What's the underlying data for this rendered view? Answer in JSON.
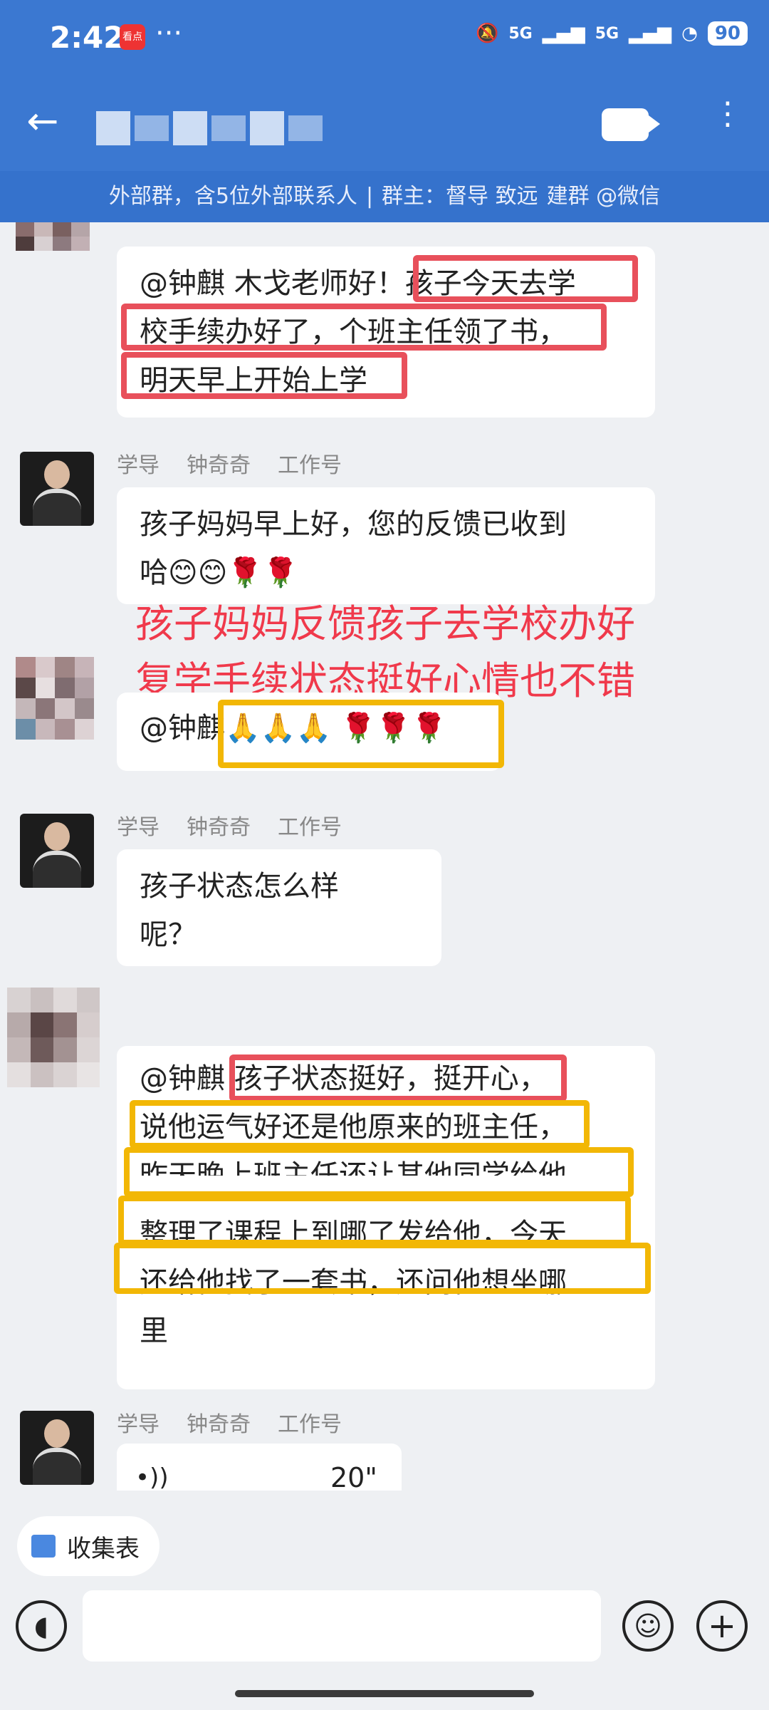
{
  "status_bar": {
    "time": "2:42",
    "app_badge": "看点",
    "dots": "···",
    "signal1": "5G",
    "signal2": "5G",
    "battery": "90"
  },
  "header": {
    "group_info": [
      "外部群，含5位外部联系人",
      "|",
      "群主：督导 致远",
      "建群 @微信"
    ]
  },
  "messages": [
    {
      "id": "m1",
      "lines": [
        "@钟麒 木戈老师好！孩子今天去学",
        "校手续办好了，个班主任领了书，",
        "明天早上开始上学"
      ]
    },
    {
      "id": "m2",
      "sender": [
        "学导",
        "钟奇奇",
        "工作号"
      ],
      "lines": [
        "孩子妈妈早上好，您的反馈已收到",
        "哈😊😊🌹🌹"
      ]
    },
    {
      "id": "m3",
      "lines": [
        "@钟麒🙏🙏🙏 🌹🌹🌹"
      ]
    },
    {
      "id": "m4",
      "sender": [
        "学导",
        "钟奇奇",
        "工作号"
      ],
      "lines": [
        "孩子状态怎么样",
        "呢？"
      ]
    },
    {
      "id": "m5",
      "lines": [
        "@钟麒 孩子状态挺好，挺开心，",
        "说他运气好还是他原来的班主任，",
        "昨天晚上班主任还让其他同学给他",
        "整理了课程上到哪了发给他，今天",
        "还给他找了一套书，还问他想坐哪",
        "里"
      ]
    },
    {
      "id": "m6",
      "sender": [
        "学导",
        "钟奇奇",
        "工作号"
      ],
      "voice_duration": "20\""
    }
  ],
  "annotation": [
    "孩子妈妈反馈孩子去学校办好",
    "复学手续状态挺好心情也不错"
  ],
  "bottom": {
    "quick_chip": "收集表",
    "input_placeholder": ""
  },
  "colors": {
    "header": "#3b78d1",
    "highlight_red": "#e8505b",
    "highlight_yellow": "#f2b705",
    "annotation": "#f0394b"
  }
}
